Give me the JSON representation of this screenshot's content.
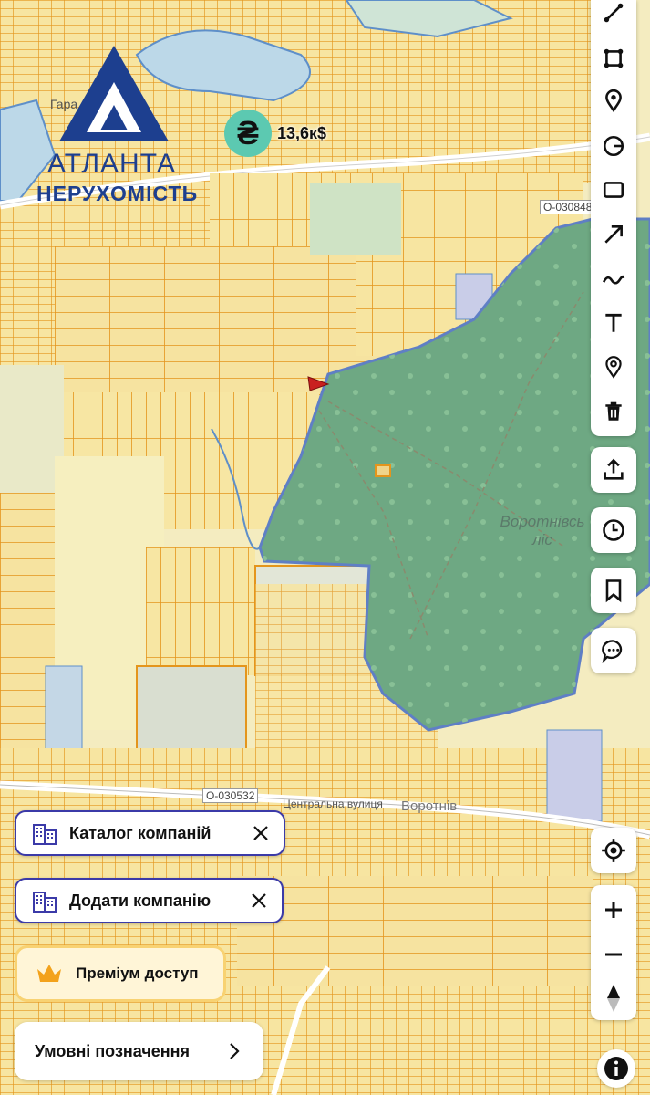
{
  "logo": {
    "line1": "АТЛАНТА",
    "line2": "НЕРУХОМІСТЬ"
  },
  "price_marker": {
    "symbol": "₴",
    "label": "13,6к$"
  },
  "map_labels": {
    "forest_line1": "Воротнівсь",
    "forest_line2": "ліс",
    "village": "Воротнів",
    "street": "Центральна вулиця",
    "road_code_1": "O-030532",
    "road_code_2": "O-030848",
    "place_top": "Гара"
  },
  "toolbar": {
    "icons": [
      "polyline-icon",
      "polygon-icon",
      "pin-icon",
      "circle-radius-icon",
      "rectangle-icon",
      "arrow-icon",
      "freehand-icon",
      "text-icon",
      "location-marker-icon",
      "trash-icon"
    ]
  },
  "side_buttons": [
    "share-icon",
    "history-icon",
    "bookmark-icon",
    "chat-icon"
  ],
  "buttons": {
    "catalog": "Каталог компаній",
    "add_company": "Додати компанію",
    "premium": "Преміум доступ",
    "legend": "Умовні позначення"
  },
  "colors": {
    "parcel_fill": "#f6e7a8",
    "parcel_stroke": "#e59a1f",
    "forest": "#6aa67e",
    "accent": "#3b3aa8",
    "marker": "#5cc9b1"
  }
}
